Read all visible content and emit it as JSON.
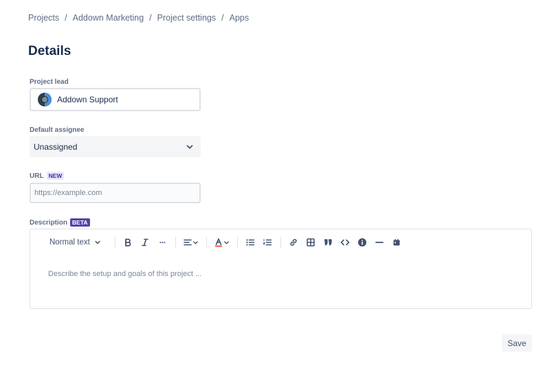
{
  "breadcrumb": {
    "items": [
      "Projects",
      "Addown Marketing",
      "Project settings",
      "Apps"
    ],
    "separator": "/"
  },
  "page": {
    "title": "Details"
  },
  "project_lead": {
    "label": "Project lead",
    "value": "Addown Support"
  },
  "default_assignee": {
    "label": "Default assignee",
    "value": "Unassigned"
  },
  "url": {
    "label": "URL",
    "badge": "NEW",
    "value": "",
    "placeholder": "https://example.com"
  },
  "description": {
    "label": "Description",
    "badge": "BETA",
    "placeholder": "Describe the setup and goals of this project ...",
    "toolbar": {
      "text_style": "Normal text",
      "more_glyph": "···",
      "icons": [
        "bold-icon",
        "italic-icon",
        "more-icon",
        "align-icon",
        "text-color-icon",
        "bullet-list-icon",
        "numbered-list-icon",
        "link-icon",
        "table-icon",
        "quote-icon",
        "code-icon",
        "info-icon",
        "divider-icon",
        "date-icon"
      ]
    }
  },
  "actions": {
    "save_label": "Save"
  },
  "colors": {
    "text_primary": "#172b4d",
    "text_secondary": "#5e6c84",
    "border": "#dfe1e6",
    "field_bg": "#f4f5f7",
    "badge_new_bg": "#eae6ff",
    "badge_beta_bg": "#5243aa"
  }
}
